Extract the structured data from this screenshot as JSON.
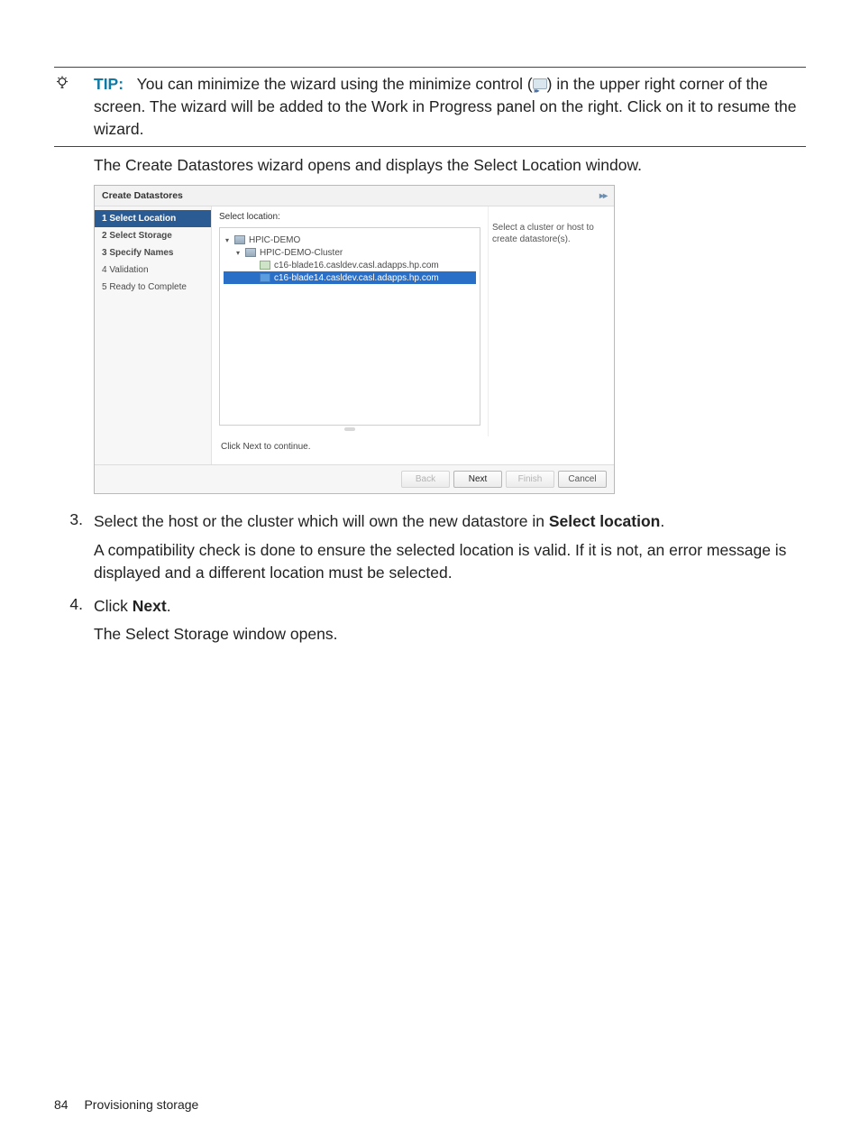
{
  "tip": {
    "label": "TIP:",
    "text_before_icon": "You can minimize the wizard using the minimize control (",
    "text_after_icon": ") in the upper right corner of the screen. The wizard will be added to the Work in Progress panel on the right. Click on it to resume the wizard."
  },
  "intro_line": "The Create Datastores wizard opens and displays the Select Location window.",
  "wizard": {
    "title": "Create Datastores",
    "minimize_glyph": "▸▸",
    "steps": [
      "1 Select Location",
      "2 Select Storage",
      "3 Specify Names",
      "4 Validation",
      "5 Ready to Complete"
    ],
    "select_heading": "Select location:",
    "tree": {
      "root": "HPIC-DEMO",
      "cluster": "HPIC-DEMO-Cluster",
      "host1": "c16-blade16.casldev.casl.adapps.hp.com",
      "host2": "c16-blade14.casldev.casl.adapps.hp.com"
    },
    "right_desc": "Select a cluster or host to create datastore(s).",
    "note": "Click Next to continue.",
    "buttons": {
      "back": "Back",
      "next": "Next",
      "finish": "Finish",
      "cancel": "Cancel"
    }
  },
  "steps_text": {
    "s3_a": "Select the host or the cluster which will own the new datastore in ",
    "s3_b": "Select location",
    "s3_c": ".",
    "s3_p2": "A compatibility check is done to ensure the selected location is valid. If it is not, an error message is displayed and a different location must be selected.",
    "s4_a": "Click ",
    "s4_b": "Next",
    "s4_c": ".",
    "s4_p2": "The Select Storage window opens."
  },
  "footer": {
    "page": "84",
    "section": "Provisioning storage"
  }
}
